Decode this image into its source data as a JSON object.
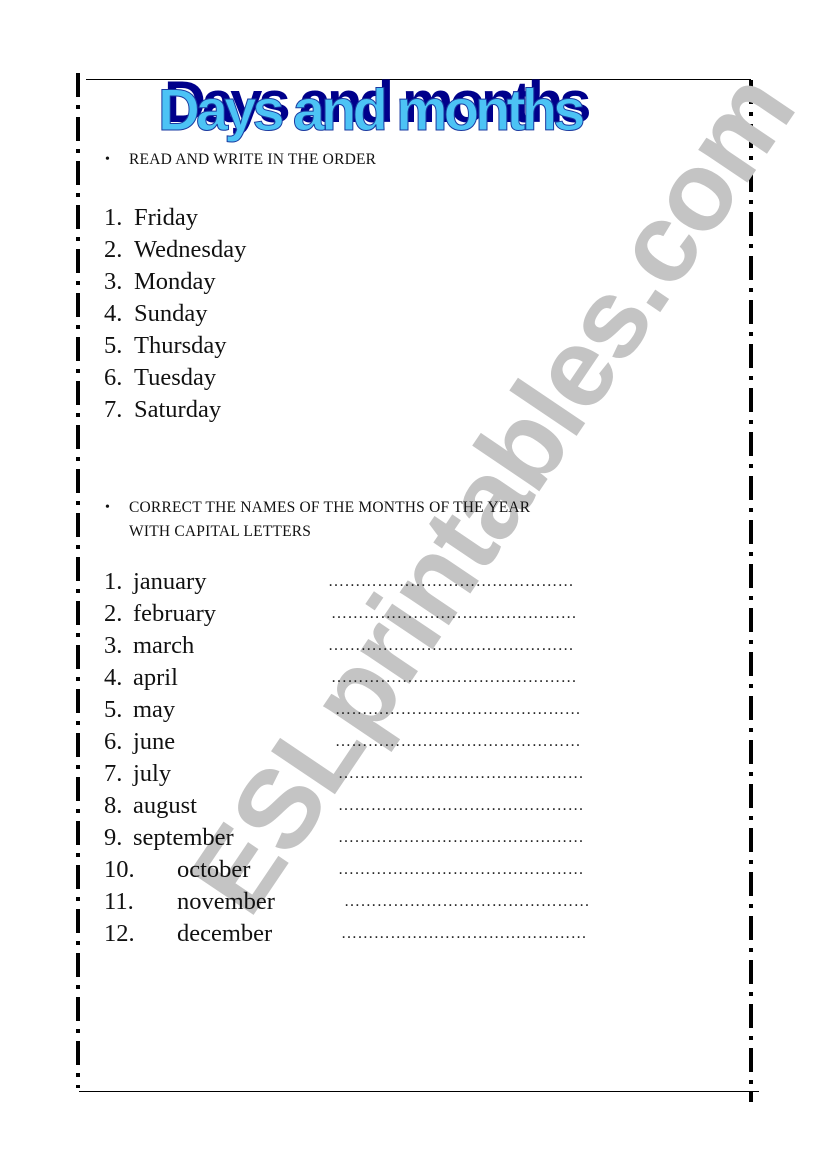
{
  "title": "Days and months",
  "watermark": "ESLprintables.com",
  "colors": {
    "title_fill": "#4cc3f5",
    "title_shadow": "#00008b",
    "watermark": "#c4c4c4"
  },
  "sections": {
    "days": {
      "instruction": "READ AND WRITE IN THE ORDER",
      "items": [
        {
          "num": "1.",
          "label": "Friday"
        },
        {
          "num": "2.",
          "label": "Wednesday"
        },
        {
          "num": "3.",
          "label": "Monday"
        },
        {
          "num": "4.",
          "label": "Sunday"
        },
        {
          "num": "5.",
          "label": "Thursday"
        },
        {
          "num": "6.",
          "label": "Tuesday"
        },
        {
          "num": "7.",
          "label": "Saturday"
        }
      ]
    },
    "months": {
      "instruction_line1": "CORRECT THE NAMES OF THE MONTHS OF THE YEAR",
      "instruction_line2": "WITH CAPITAL LETTERS",
      "blank": "………………………………………",
      "items": [
        {
          "num": "1.",
          "label": "january"
        },
        {
          "num": "2.",
          "label": "february"
        },
        {
          "num": "3.",
          "label": "march"
        },
        {
          "num": "4.",
          "label": "april"
        },
        {
          "num": "5.",
          "label": "may"
        },
        {
          "num": "6.",
          "label": "june"
        },
        {
          "num": "7.",
          "label": "july"
        },
        {
          "num": "8.",
          "label": "august"
        },
        {
          "num": "9.",
          "label": "september"
        },
        {
          "num": "10.",
          "label": "october"
        },
        {
          "num": "11.",
          "label": "november"
        },
        {
          "num": "12.",
          "label": "december"
        }
      ]
    }
  },
  "bullet": "•"
}
